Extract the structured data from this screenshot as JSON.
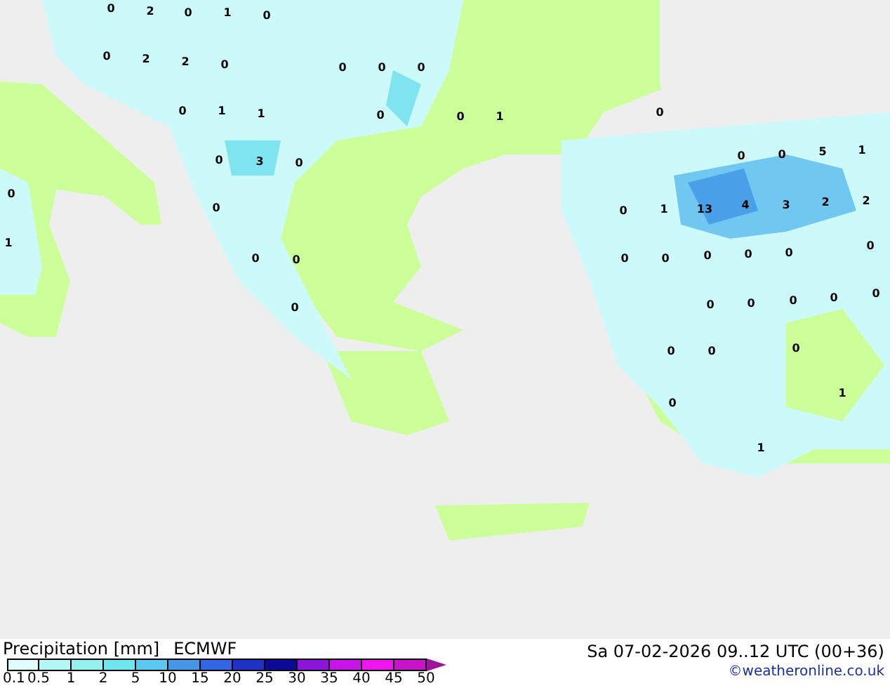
{
  "map": {
    "values": [
      "0",
      "2",
      "0",
      "1",
      "0",
      "0",
      "2",
      "2",
      "0",
      "0",
      "0",
      "0",
      "0",
      "1",
      "1",
      "0",
      "0",
      "3",
      "0",
      "0",
      "0",
      "1",
      "0",
      "0",
      "0",
      "0",
      "1",
      "0",
      "0",
      "0",
      "5",
      "1",
      "0",
      "1",
      "13",
      "4",
      "3",
      "2",
      "2",
      "0",
      "0",
      "0",
      "0",
      "0",
      "0",
      "0",
      "0",
      "0",
      "0",
      "0",
      "0",
      "0",
      "0",
      "1",
      "0",
      "1"
    ]
  },
  "legend": {
    "title": "Precipitation [mm]",
    "model": "ECMWF",
    "bins": [
      {
        "color": "#e0fcfc"
      },
      {
        "color": "#b4f5f5"
      },
      {
        "color": "#96f0f0"
      },
      {
        "color": "#6ee6f0"
      },
      {
        "color": "#5ac8f0"
      },
      {
        "color": "#4696e6"
      },
      {
        "color": "#3264e6"
      },
      {
        "color": "#1e32c8"
      },
      {
        "color": "#0a0a96"
      },
      {
        "color": "#8c14dc"
      },
      {
        "color": "#c814e6"
      },
      {
        "color": "#f014f0"
      },
      {
        "color": "#c814c8"
      }
    ],
    "ticks": [
      "0.1",
      "0.5",
      "1",
      "2",
      "5",
      "10",
      "15",
      "20",
      "25",
      "30",
      "35",
      "40",
      "45",
      "50"
    ]
  },
  "valid_time": "Sa 07-02-2026 09..12 UTC (00+36)",
  "credit": "©weatheronline.co.uk"
}
